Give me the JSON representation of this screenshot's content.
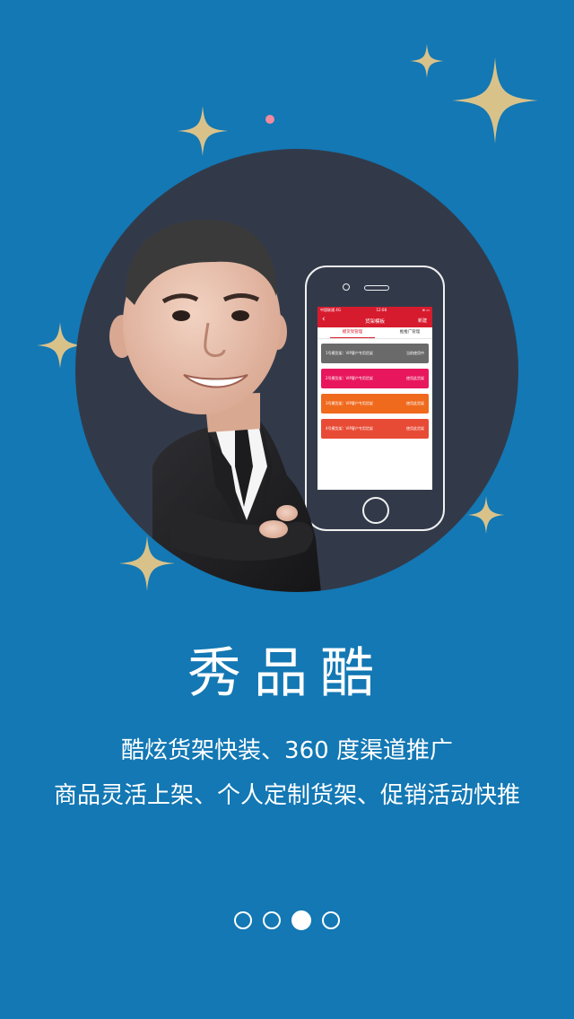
{
  "colors": {
    "background": "#1378b4",
    "circle": "#323a4a",
    "star": "#d9c28a",
    "app_red": "#d71b2e",
    "row_gray": "#6a6a6a",
    "row_pink": "#e8175d",
    "row_orange": "#f06a1e",
    "row_redorange": "#e84b35"
  },
  "phone": {
    "status": {
      "carrier": "中国联通 4G",
      "time": "12:08",
      "battery": "⊕ ▭"
    },
    "nav": {
      "back_icon": "chevron-left-icon",
      "title": "货架模板",
      "new_label": "新建"
    },
    "tabs": [
      {
        "label": "模货架管理",
        "active": true
      },
      {
        "label": "推推广管理",
        "active": false
      }
    ],
    "rows": [
      {
        "left": "1号模货架：VIP客户专用货架",
        "right": "当前使用中",
        "color": "gray"
      },
      {
        "left": "2号模货架：VIP客户专用货架",
        "right": "使用此货架",
        "color": "pink"
      },
      {
        "left": "3号模货架：VIP客户专用货架",
        "right": "使用此货架",
        "color": "orange"
      },
      {
        "left": "4号模货架：VIP客户专用货架",
        "right": "使用此货架",
        "color": "redorange"
      }
    ]
  },
  "content": {
    "title": "秀品酷",
    "line1": "酷炫货架快装、360 度渠道推广",
    "line2": "商品灵活上架、个人定制货架、促销活动快推"
  },
  "pager": {
    "count": 4,
    "active_index": 2
  }
}
